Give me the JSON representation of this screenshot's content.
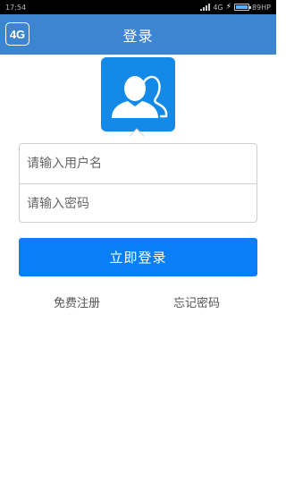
{
  "status_bar": {
    "time": "17:54",
    "network": "4G",
    "battery": "89HP"
  },
  "header": {
    "logo_text": "4G",
    "title": "登录"
  },
  "login_form": {
    "username_placeholder": "请输入用户名",
    "password_placeholder": "请输入密码",
    "submit_label": "立即登录"
  },
  "links": {
    "register": "免费注册",
    "forgot_password": "忘记密码"
  },
  "colors": {
    "header_bg": "#3d85d0",
    "avatar_bg": "#148ae8",
    "button_bg": "#0a7ff5"
  },
  "icons": {
    "avatar": "users-icon",
    "signal": "signal-icon",
    "battery": "battery-icon",
    "charging": "bolt-icon"
  }
}
